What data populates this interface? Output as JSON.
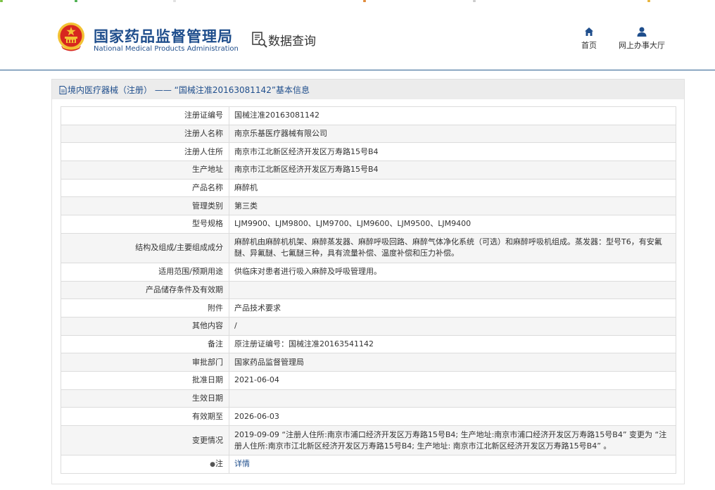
{
  "header": {
    "site_title_cn": "国家药品监督管理局",
    "site_title_en": "National Medical Products Administration",
    "query_title": "数据查询",
    "nav": [
      {
        "label": "首页",
        "icon": "home-icon"
      },
      {
        "label": "网上办事大厅",
        "icon": "user-icon"
      }
    ]
  },
  "panel": {
    "title": "境内医疗器械（注册） ——  “国械注准20163081142”基本信息"
  },
  "rows": [
    {
      "label": "注册证编号",
      "value": "国械注准20163081142"
    },
    {
      "label": "注册人名称",
      "value": "南京乐基医疗器械有限公司"
    },
    {
      "label": "注册人住所",
      "value": "南京市江北新区经济开发区万寿路15号B4"
    },
    {
      "label": "生产地址",
      "value": "南京市江北新区经济开发区万寿路15号B4"
    },
    {
      "label": "产品名称",
      "value": "麻醉机"
    },
    {
      "label": "管理类别",
      "value": "第三类"
    },
    {
      "label": "型号规格",
      "value": "LJM9900、LJM9800、LJM9700、LJM9600、LJM9500、LJM9400"
    },
    {
      "label": "结构及组成/主要组成成分",
      "value": "麻醉机由麻醉机机架、麻醉蒸发器、麻醉呼吸回路、麻醉气体净化系统（可选）和麻醉呼吸机组成。蒸发器：型号T6，有安氟醚、异氟醚、七氟醚三种，具有流量补偿、温度补偿和压力补偿。"
    },
    {
      "label": "适用范围/预期用途",
      "value": "供临床对患者进行吸入麻醉及呼吸管理用。"
    },
    {
      "label": "产品储存条件及有效期",
      "value": ""
    },
    {
      "label": "附件",
      "value": "产品技术要求"
    },
    {
      "label": "其他内容",
      "value": "/"
    },
    {
      "label": "备注",
      "value": "原注册证编号：国械注准20163541142"
    },
    {
      "label": "审批部门",
      "value": "国家药品监督管理局"
    },
    {
      "label": "批准日期",
      "value": "2021-06-04"
    },
    {
      "label": "生效日期",
      "value": ""
    },
    {
      "label": "有效期至",
      "value": "2026-06-03"
    },
    {
      "label": "变更情况",
      "value": "2019-09-09 “注册人住所:南京市浦口经济开发区万寿路15号B4; 生产地址:南京市浦口经济开发区万寿路15号B4” 变更为 “注册人住所:南京市江北新区经济开发区万寿路15号B4; 生产地址: 南京市江北新区经济开发区万寿路15号B4” 。"
    },
    {
      "label": "注",
      "value": "详情"
    }
  ],
  "colors": {
    "brand_blue": "#1f4e8c",
    "header_rule": "#2a5d8f",
    "emblem_red": "#d7261f",
    "emblem_gold": "#f3c233"
  }
}
